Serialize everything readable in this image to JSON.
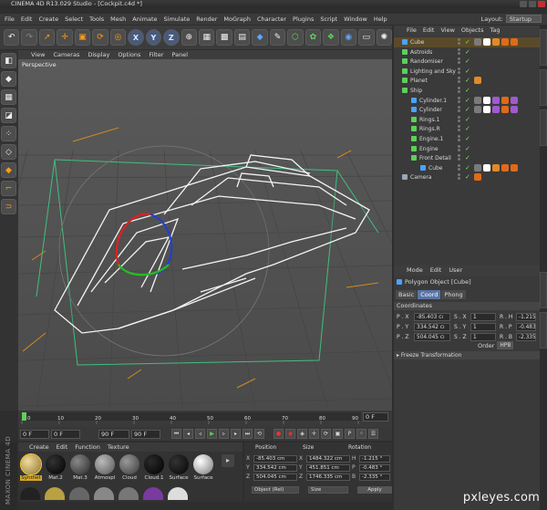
{
  "titlebar": {
    "title": "CINEMA 4D R13.029 Studio - [Cockpit.c4d *]"
  },
  "menubar": {
    "items": [
      "File",
      "Edit",
      "Create",
      "Select",
      "Tools",
      "Mesh",
      "Animate",
      "Simulate",
      "Render",
      "MoGraph",
      "Character",
      "Plugins",
      "Script",
      "Window",
      "Help"
    ]
  },
  "layout": {
    "label": "Layout:",
    "value": "Startup"
  },
  "toolbar": {
    "icons": [
      "undo-icon",
      "redo-icon",
      "select-icon",
      "move-icon",
      "scale-icon",
      "rotate-icon",
      "recent-icon",
      "x-axis-icon",
      "y-axis-icon",
      "z-axis-icon",
      "world-icon",
      "render-region-icon",
      "render-view-icon",
      "render-settings-icon",
      "cube-icon",
      "pen-icon",
      "subdivision-icon",
      "array-icon",
      "deformer-icon",
      "scene-icon",
      "camera-icon",
      "light-icon"
    ],
    "x_label": "X",
    "y_label": "Y",
    "z_label": "Z"
  },
  "viewport": {
    "menu": [
      "View",
      "Cameras",
      "Display",
      "Options",
      "Filter",
      "Panel"
    ],
    "label": "Perspective"
  },
  "timeline": {
    "ticks": [
      "0",
      "10",
      "20",
      "30",
      "40",
      "50",
      "60",
      "70",
      "80",
      "90"
    ],
    "current_frame": "0 F"
  },
  "playbar": {
    "start": "0 F",
    "current": "0 F",
    "end": "90 F",
    "end2": "90 F"
  },
  "materials": {
    "menu": [
      "Create",
      "Edit",
      "Function",
      "Texture"
    ],
    "items": [
      {
        "label": "Synthet",
        "color": "#d8c07a"
      },
      {
        "label": "Mat.2",
        "color": "#050505"
      },
      {
        "label": "Mat.3",
        "color": "#5a5a5a"
      },
      {
        "label": "Atmospl",
        "color": "#9a9a9a"
      },
      {
        "label": "Cloud",
        "color": "#707070"
      },
      {
        "label": "Cloud.1",
        "color": "#111111"
      },
      {
        "label": "Surface",
        "color": "#1a1a1a"
      },
      {
        "label": "Surface",
        "color": "#bfbfbf"
      }
    ]
  },
  "coords": {
    "headers": [
      "Position",
      "Size",
      "Rotation"
    ],
    "rows": [
      {
        "axis": "X",
        "pos": "-85.403 cm",
        "size": "1484.322 cm",
        "rlabel": "H",
        "rot": "-1.215 °"
      },
      {
        "axis": "Y",
        "pos": "334.542 cm",
        "size": "451.851 cm",
        "rlabel": "P",
        "rot": "-0.483 °"
      },
      {
        "axis": "Z",
        "pos": "504.045 cm",
        "size": "1746.335 cm",
        "rlabel": "B",
        "rot": "-2.335 °"
      }
    ],
    "mode": "Object (Rel)",
    "size_mode": "Size",
    "apply": "Apply"
  },
  "brand": {
    "text": "MAXON CINEMA 4D"
  },
  "objects": {
    "menu": [
      "File",
      "Edit",
      "View",
      "Objects",
      "Tag"
    ],
    "items": [
      {
        "name": "Cube",
        "indent": 0,
        "icon": "#4aa3ff",
        "selected": true,
        "tags": [
          "#7a7a7a",
          "#ffffff",
          "#e08a2a",
          "#e06a1a",
          "#e06a1a"
        ]
      },
      {
        "name": "Astroids",
        "indent": 0,
        "icon": "#5bd05b",
        "selected": false,
        "tags": []
      },
      {
        "name": "Randomiser",
        "indent": 0,
        "icon": "#5bd05b",
        "selected": false,
        "tags": []
      },
      {
        "name": "Lighting and Sky",
        "indent": 0,
        "icon": "#5bd05b",
        "selected": false,
        "tags": []
      },
      {
        "name": "Planet",
        "indent": 0,
        "icon": "#5bd05b",
        "selected": false,
        "tags": [
          "#e08a2a"
        ]
      },
      {
        "name": "Ship",
        "indent": 0,
        "icon": "#5bd05b",
        "selected": false,
        "tags": []
      },
      {
        "name": "Cylinder.1",
        "indent": 1,
        "icon": "#4aa3ff",
        "selected": false,
        "tags": [
          "#7a7a7a",
          "#ffffff",
          "#a05ad0",
          "#e06a1a",
          "#a05ad0"
        ]
      },
      {
        "name": "Cylinder",
        "indent": 1,
        "icon": "#4aa3ff",
        "selected": false,
        "tags": [
          "#7a7a7a",
          "#ffffff",
          "#a05ad0",
          "#e06a1a",
          "#a05ad0"
        ]
      },
      {
        "name": "Rings.1",
        "indent": 1,
        "icon": "#5bd05b",
        "selected": false,
        "tags": []
      },
      {
        "name": "Rings.R",
        "indent": 1,
        "icon": "#5bd05b",
        "selected": false,
        "tags": []
      },
      {
        "name": "Engine.1",
        "indent": 1,
        "icon": "#5bd05b",
        "selected": false,
        "tags": []
      },
      {
        "name": "Engine",
        "indent": 1,
        "icon": "#5bd05b",
        "selected": false,
        "tags": []
      },
      {
        "name": "Front Detail",
        "indent": 1,
        "icon": "#5bd05b",
        "selected": false,
        "tags": []
      },
      {
        "name": "Cube",
        "indent": 2,
        "icon": "#4aa3ff",
        "selected": false,
        "tags": [
          "#7a7a7a",
          "#ffffff",
          "#e08a2a",
          "#e06a1a",
          "#e06a1a"
        ]
      },
      {
        "name": "Camera",
        "indent": 0,
        "icon": "#9aa6b8",
        "selected": false,
        "tags": [
          "#e06a1a"
        ]
      }
    ]
  },
  "attributes": {
    "menu": [
      "Mode",
      "Edit",
      "User"
    ],
    "title": "Polygon Object [Cube]",
    "tabs": [
      "Basic",
      "Coord",
      "Phong"
    ],
    "active_tab": "Coord",
    "section": "Coordinates",
    "rows": [
      {
        "plabel": "P . X",
        "pval": "-85.403 cı",
        "slabel": "S . X",
        "sval": "1",
        "rlabel": "R . H",
        "rval": "-1.215"
      },
      {
        "plabel": "P . Y",
        "pval": "334.542 cı",
        "slabel": "S . Y",
        "sval": "1",
        "rlabel": "R . P",
        "rval": "-0.483"
      },
      {
        "plabel": "P . Z",
        "pval": "504.045 cı",
        "slabel": "S . Z",
        "sval": "1",
        "rlabel": "R . B",
        "rval": "-2.335"
      }
    ],
    "order_label": "Order",
    "order_value": "HPB",
    "freeze": "Freeze Transformation"
  },
  "watermark": "pxleyes.com"
}
